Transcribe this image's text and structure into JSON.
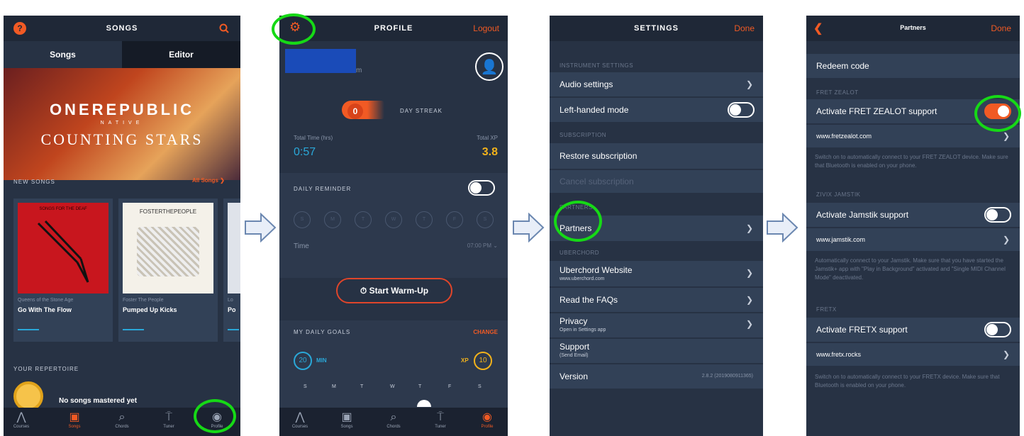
{
  "accent": "#f15a24",
  "highlight": "#16d916",
  "p1": {
    "title": "SONGS",
    "seg": [
      "Songs",
      "Editor"
    ],
    "banner_band": "ONEREPUBLIC",
    "banner_sub": "NATIVE",
    "banner_song": "COUNTING STARS",
    "new_songs": "NEW SONGS",
    "all_songs": "All Songs",
    "cards": [
      {
        "artist": "Queens of the Stone Age",
        "song": "Go With The Flow",
        "art": "SONGS FOR THE DEAF"
      },
      {
        "artist": "Foster The People",
        "song": "Pumped Up Kicks",
        "art": "FOSTERTHEPEOPLE"
      },
      {
        "artist": "Lo",
        "song": "Po",
        "art": ""
      }
    ],
    "repertoire": "YOUR REPERTOIRE",
    "repertoire_msg": "No songs mastered yet",
    "tabs": [
      "Courses",
      "Songs",
      "Chords",
      "Tuner",
      "Profile"
    ]
  },
  "p2": {
    "title": "PROFILE",
    "logout": "Logout",
    "email_tail": "m",
    "streak_num": "0",
    "streak_label": "DAY STREAK",
    "total_time_label": "Total Time (hrs)",
    "total_time": "0:57",
    "total_xp_label": "Total XP",
    "total_xp": "3.8",
    "reminder": "DAILY REMINDER",
    "days": [
      "S",
      "M",
      "T",
      "W",
      "T",
      "F",
      "S"
    ],
    "time_label": "Time",
    "time_value": "07:00 PM",
    "warmup": "Start Warm-Up",
    "goals": "MY DAILY GOALS",
    "change": "CHANGE",
    "goal_min_value": "20",
    "goal_min_unit": "MIN",
    "goal_xp_unit": "XP",
    "goal_xp_value": "10",
    "week": [
      "S",
      "M",
      "T",
      "W",
      "T",
      "F",
      "S"
    ],
    "tabs": [
      "Courses",
      "Songs",
      "Chords",
      "Tuner",
      "Profile"
    ]
  },
  "p3": {
    "title": "SETTINGS",
    "done": "Done",
    "sec_instrument": "INSTRUMENT SETTINGS",
    "audio": "Audio settings",
    "lefthand": "Left-handed mode",
    "sec_sub": "SUBSCRIPTION",
    "restore": "Restore subscription",
    "cancel": "Cancel subscription",
    "sec_partners": "PARTNERS",
    "partners": "Partners",
    "sec_uberchord": "UBERCHORD",
    "website": "Uberchord Website",
    "website_sub": "www.uberchord.com",
    "faq": "Read the FAQs",
    "privacy": "Privacy",
    "privacy_sub": "Open in Settings app",
    "support": "Support",
    "support_sub": "(Send Email)",
    "version_label": "Version",
    "version_value": "2.8.2 (2019080911365)"
  },
  "p4": {
    "title": "Partners",
    "done": "Done",
    "redeem": "Redeem code",
    "sec_fret": "FRET ZEALOT",
    "fret_toggle": "Activate FRET ZEALOT support",
    "fret_link": "www.fretzealot.com",
    "fret_help": "Switch on to automatically connect to your FRET ZEALOT device. Make sure that Bluetooth is enabled on your phone.",
    "sec_jam": "ZIVIX JAMSTIK",
    "jam_toggle": "Activate Jamstik support",
    "jam_link": "www.jamstik.com",
    "jam_help": "Automatically connect to your Jamstik. Make sure that you have started the Jamstik+ app with \"Play in Background\" activated and \"Single MIDI Channel Mode\" deactivated.",
    "sec_fretx": "FRETX",
    "fretx_toggle": "Activate FRETX support",
    "fretx_link": "www.fretx.rocks",
    "fretx_help": "Switch on to automatically connect to your FRETX device. Make sure that Bluetooth is enabled on your phone."
  }
}
